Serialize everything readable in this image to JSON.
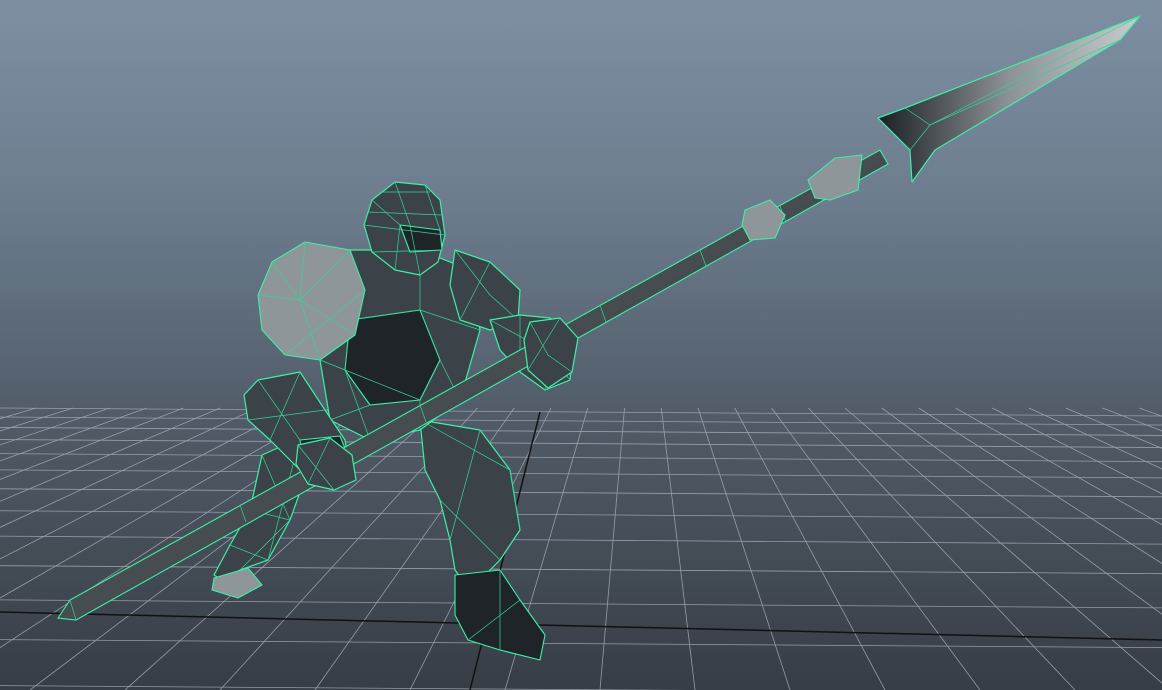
{
  "viewport": {
    "name": "3d-viewport",
    "background_top": "#7d8fa2",
    "background_bottom": "#373d45",
    "grid_color": "#a4acb4",
    "grid_axis_color": "#111111",
    "wireframe_color": "#3cf0a8"
  },
  "model": {
    "subject": "armored-spearman",
    "display_mode": "wireframe-on-shaded",
    "selected": true
  }
}
